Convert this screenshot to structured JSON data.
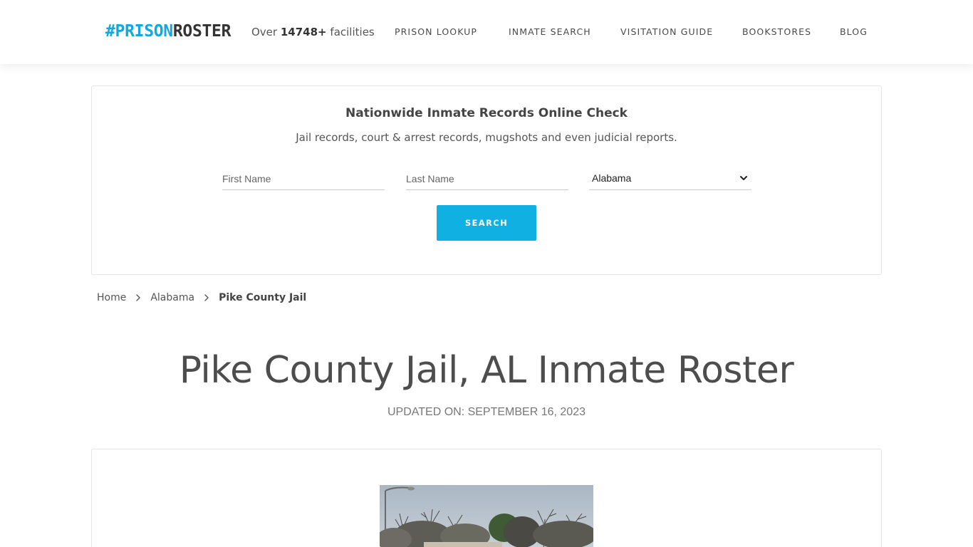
{
  "header": {
    "logo_hash": "#PRISON",
    "logo_rest": "ROSTER",
    "facilities_prefix": "Over",
    "facilities_count": "14748+",
    "facilities_suffix": "facilities",
    "nav": [
      "PRISON LOOKUP",
      "INMATE SEARCH",
      "VISITATION GUIDE",
      "BOOKSTORES",
      "BLOG"
    ]
  },
  "search": {
    "title": "Nationwide Inmate Records Online Check",
    "subtitle": "Jail records, court & arrest records, mugshots and even judicial reports.",
    "first_name_placeholder": "First Name",
    "last_name_placeholder": "Last Name",
    "state_selected": "Alabama",
    "button_label": "SEARCH",
    "button_color": "#11b0e2"
  },
  "breadcrumb": {
    "home": "Home",
    "state": "Alabama",
    "current": "Pike County Jail"
  },
  "page": {
    "title": "Pike County Jail, AL Inmate Roster",
    "updated": "UPDATED ON: SEPTEMBER 16, 2023"
  },
  "icons": {
    "breadcrumb_separator": "chevron-right-icon",
    "select_arrow": "chevron-down-icon"
  },
  "colors": {
    "brand_blue": "#11a9dc",
    "brand_dark": "#333333"
  }
}
